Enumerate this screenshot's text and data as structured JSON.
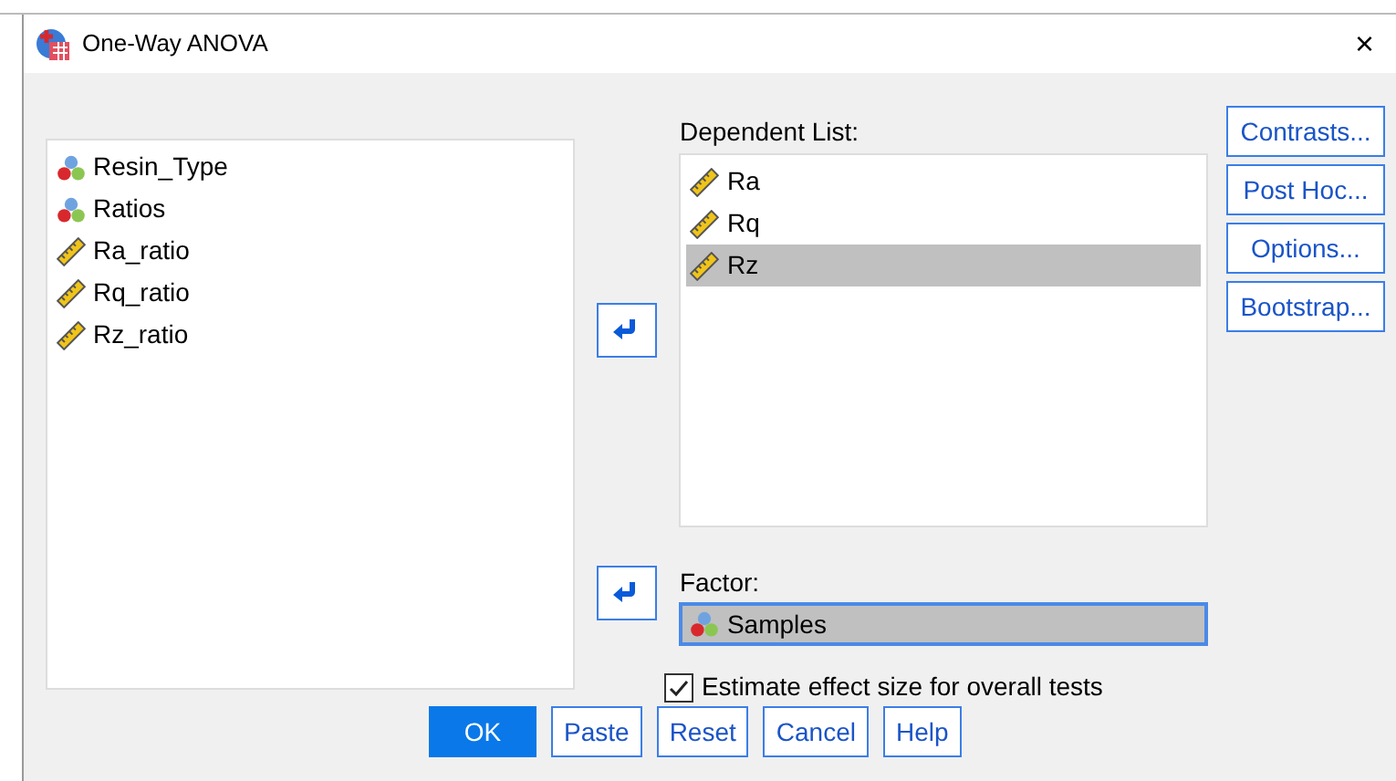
{
  "window": {
    "title": "One-Way ANOVA",
    "close": "×"
  },
  "variables": [
    {
      "name": "Resin_Type",
      "kind": "nominal",
      "selected": false
    },
    {
      "name": "Ratios",
      "kind": "nominal",
      "selected": false
    },
    {
      "name": "Ra_ratio",
      "kind": "scale",
      "selected": false
    },
    {
      "name": "Rq_ratio",
      "kind": "scale",
      "selected": false
    },
    {
      "name": "Rz_ratio",
      "kind": "scale",
      "selected": false
    }
  ],
  "dependent_list": {
    "label": "Dependent List:",
    "items": [
      {
        "name": "Ra",
        "kind": "scale",
        "selected": false
      },
      {
        "name": "Rq",
        "kind": "scale",
        "selected": false
      },
      {
        "name": "Rz",
        "kind": "scale",
        "selected": true
      }
    ]
  },
  "factor": {
    "label": "Factor:",
    "value": "Samples",
    "kind": "nominal",
    "focused": true
  },
  "effect_size": {
    "label": "Estimate effect size for overall tests",
    "checked": true
  },
  "side_buttons": [
    "Contrasts...",
    "Post Hoc...",
    "Options...",
    "Bootstrap..."
  ],
  "bottom_buttons": [
    {
      "label": "OK",
      "default": true
    },
    {
      "label": "Paste",
      "default": false
    },
    {
      "label": "Reset",
      "default": false
    },
    {
      "label": "Cancel",
      "default": false
    },
    {
      "label": "Help",
      "default": false
    }
  ]
}
